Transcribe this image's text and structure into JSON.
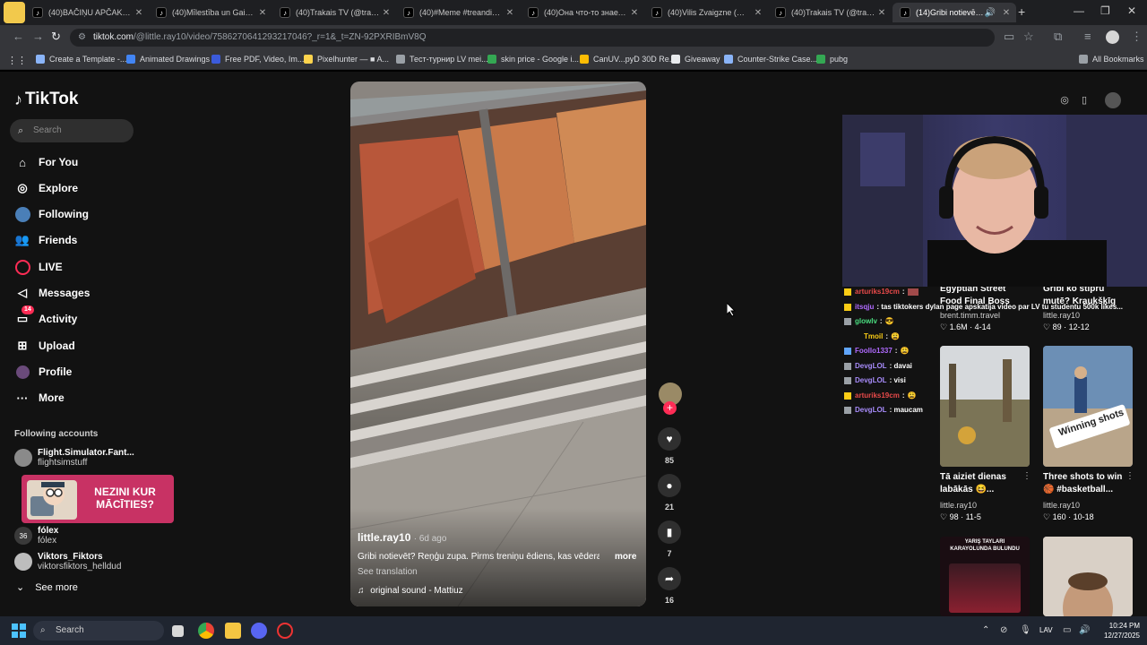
{
  "browser": {
    "tabs": [
      {
        "label": "(40)BAČIŅU APČAKARĒJA",
        "active": false
      },
      {
        "label": "(40)Mīlestība un Gaisma",
        "active": false
      },
      {
        "label": "(40)Trakais TV (@trakais_",
        "active": false
      },
      {
        "label": "(40)#Meme #treanding #",
        "active": false
      },
      {
        "label": "(40)Она что-то знает | Ti",
        "active": false
      },
      {
        "label": "(40)Vilis Zvaigzne (@vilis",
        "active": false
      },
      {
        "label": "(40)Trakais TV (@trakais_",
        "active": false
      },
      {
        "label": "(14)Gribi notievēt? Re",
        "active": true
      }
    ],
    "url_host": "tiktok.com",
    "url_path": "/@little.ray10/video/7586270641293217046?_r=1&_t=ZN-92PXRIBmV8Q",
    "bookmarks": [
      {
        "label": "Create a Template -...",
        "color": "#8ab4f8"
      },
      {
        "label": "Animated Drawings",
        "color": "#4285f4"
      },
      {
        "label": "Free PDF, Video, Im...",
        "color": "#3b5bdb"
      },
      {
        "label": "Pixelhunter — ■ A...",
        "color": "#fcd34d"
      },
      {
        "label": "Тест-турнир LV mei...",
        "color": "#9aa0a6"
      },
      {
        "label": "skin price - Google i...",
        "color": "#34a853"
      },
      {
        "label": "CanUV...pyD 30D Re...",
        "color": "#fbbc04"
      },
      {
        "label": "Giveaway",
        "color": "#e8eaed"
      },
      {
        "label": "Counter-Strike Case...",
        "color": "#8ab4f8"
      },
      {
        "label": "pubg",
        "color": "#34a853"
      }
    ],
    "all_bookmarks": "All Bookmarks"
  },
  "sidebar": {
    "logo": "TikTok",
    "search_placeholder": "Search",
    "nav": [
      {
        "label": "For You",
        "icon": "home-icon"
      },
      {
        "label": "Explore",
        "icon": "compass-icon"
      },
      {
        "label": "Following",
        "icon": "avatar-icon"
      },
      {
        "label": "Friends",
        "icon": "friends-icon"
      },
      {
        "label": "LIVE",
        "icon": "live-icon"
      },
      {
        "label": "Messages",
        "icon": "messages-icon"
      },
      {
        "label": "Activity",
        "icon": "activity-icon",
        "badge": "14"
      },
      {
        "label": "Upload",
        "icon": "upload-icon"
      },
      {
        "label": "Profile",
        "icon": "profile-icon"
      },
      {
        "label": "More",
        "icon": "more-icon"
      }
    ],
    "following_title": "Following accounts",
    "accounts": [
      {
        "name": "Flight.Simulator.Fant...",
        "user": "flightsimstuff"
      },
      {
        "name": "fólex",
        "user": "fólex"
      },
      {
        "name": "Viktors_Fiktors",
        "user": "viktorsfiktors_helldud"
      }
    ],
    "ad_text": "NEZINI KUR MĀCĪTIES?",
    "see_more": "See more"
  },
  "video": {
    "username": "little.ray10",
    "date": "· 6d ago",
    "description": "Gribi notievēt? Reņģu zupa. Pirms treniņu ēdiens, kas vēdera",
    "more": "more",
    "see_translation": "See translation",
    "sound": "original sound - Mattiuz",
    "likes": "85",
    "comments": "21",
    "saves": "7",
    "shares": "16"
  },
  "chat": [
    {
      "user": "arturiks19cm",
      "msg": ":",
      "color": "#e84a4a"
    },
    {
      "user": "itsqju",
      "msg": ": tas tiktokers dylan page apskatija video par LV tu studentu 500k likes...",
      "color": "#b06bff"
    },
    {
      "user": "glowlv",
      "msg": ":",
      "color": "#4ade80"
    },
    {
      "user": "Tmoil",
      "msg": ":",
      "color": "#facc15"
    },
    {
      "user": "Foollo1337",
      "msg": ":",
      "color": "#b06bff"
    },
    {
      "user": "DevgLOL",
      "msg": ": davai",
      "color": "#a78bfa"
    },
    {
      "user": "DevgLOL",
      "msg": ": visi",
      "color": "#a78bfa"
    },
    {
      "user": "arturiks19cm",
      "msg": ":",
      "color": "#e84a4a"
    },
    {
      "user": "DevgLOL",
      "msg": ": maucam",
      "color": "#a78bfa"
    }
  ],
  "grid": [
    {
      "caption": "Egyptian Street Food Final Boss",
      "author": "brent.timm.travel",
      "views": "1.6M",
      "date": "4-14"
    },
    {
      "caption": "Gribi ko stiprū mutē? Kraukšķīg",
      "author": "little.ray10",
      "views": "89",
      "date": "12-12"
    },
    {
      "caption": "Tā aiziet dienas labākās 😆...",
      "author": "little.ray10",
      "views": "98",
      "date": "11-5"
    },
    {
      "caption": "Three shots to win 🏀 #basketball...",
      "author": "little.ray10",
      "views": "160",
      "date": "10-18"
    },
    {
      "caption": "YARIŞ TAYLARI KARAYOLUNDA BULUNDU",
      "author": "",
      "views": "",
      "date": ""
    }
  ],
  "thumb_overlay": "Winning shots",
  "taskbar": {
    "search": "Search",
    "lang": "LAV",
    "time": "10:24 PM",
    "date": "12/27/2025"
  }
}
